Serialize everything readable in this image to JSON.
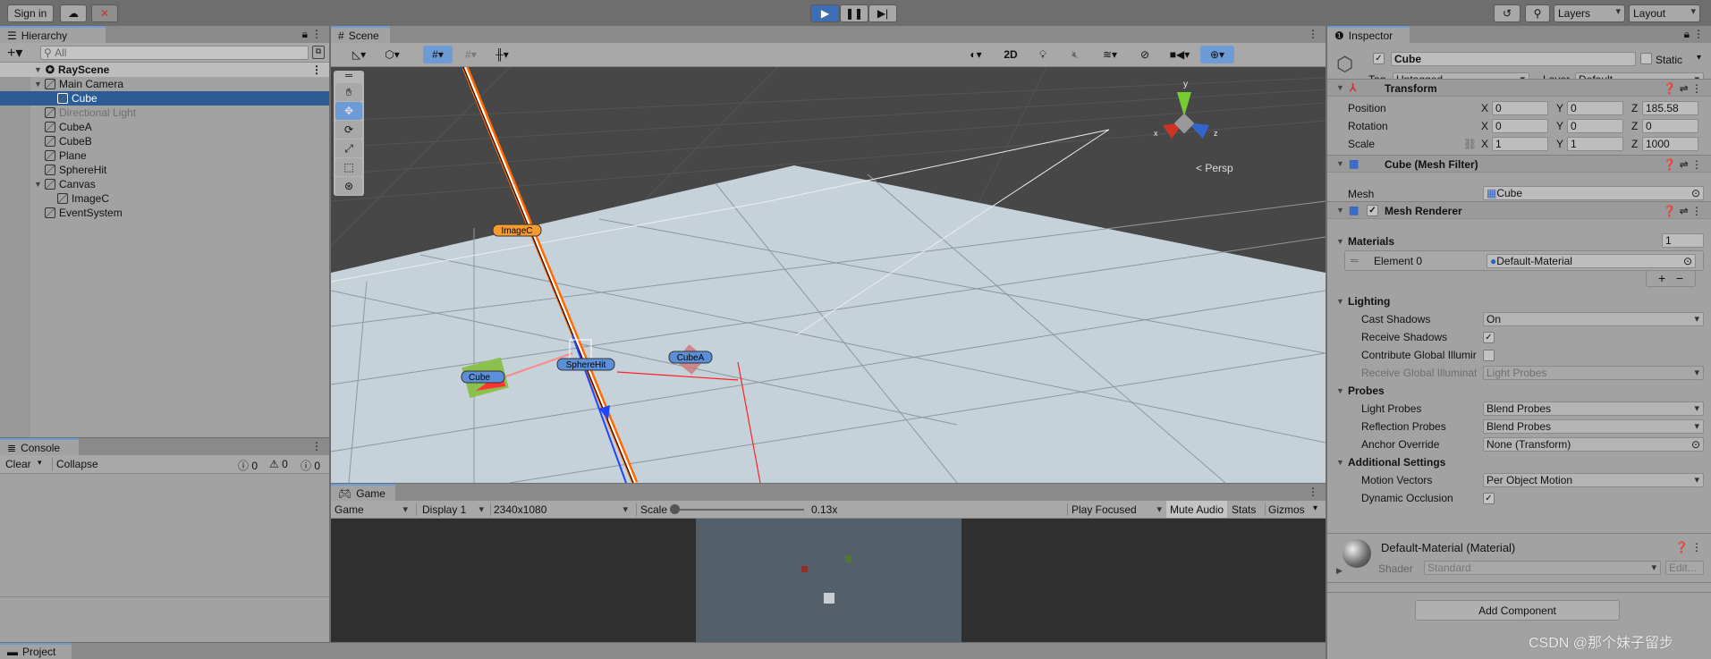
{
  "topbar": {
    "sign_in": "Sign in",
    "layers": "Layers",
    "layout": "Layout",
    "accent": "#3d6eb4"
  },
  "hierarchy": {
    "tab": "Hierarchy",
    "search_placeholder": "All",
    "scene": "RayScene",
    "items": [
      {
        "label": "Main Camera",
        "depth": 1,
        "expanded": true
      },
      {
        "label": "Cube",
        "depth": 2,
        "selected": true
      },
      {
        "label": "Directional Light",
        "depth": 1,
        "disabled": true
      },
      {
        "label": "CubeA",
        "depth": 1
      },
      {
        "label": "CubeB",
        "depth": 1
      },
      {
        "label": "Plane",
        "depth": 1
      },
      {
        "label": "SphereHit",
        "depth": 1
      },
      {
        "label": "Canvas",
        "depth": 1,
        "expanded": true
      },
      {
        "label": "ImageC",
        "depth": 2
      },
      {
        "label": "EventSystem",
        "depth": 1
      }
    ]
  },
  "console": {
    "tab": "Console",
    "clear": "Clear",
    "collapse": "Collapse",
    "logs": "0",
    "warnings": "0",
    "errors": "0"
  },
  "scene": {
    "tab": "Scene",
    "btn_2d": "2D",
    "persp": "Persp",
    "axis_x": "x",
    "axis_y": "y",
    "axis_z": "z",
    "labels": {
      "imagec": "ImageC",
      "spherehit": "SphereHit",
      "cubea": "CubeA",
      "cubeb": "Cube"
    }
  },
  "game": {
    "tab": "Game",
    "view": "Game",
    "display": "Display 1",
    "resolution": "2340x1080",
    "scale_label": "Scale",
    "scale_value": "0.13x",
    "play_focused": "Play Focused",
    "mute": "Mute Audio",
    "stats": "Stats",
    "gizmos": "Gizmos"
  },
  "project": {
    "tab": "Project"
  },
  "inspector": {
    "tab": "Inspector",
    "name": "Cube",
    "active": true,
    "static": "Static",
    "tag_label": "Tag",
    "tag": "Untagged",
    "layer_label": "Layer",
    "layer": "Default",
    "transform": {
      "title": "Transform",
      "position": "Position",
      "rotation": "Rotation",
      "scale": "Scale",
      "pos": [
        "0",
        "0",
        "185.58"
      ],
      "rot": [
        "0",
        "0",
        "0"
      ],
      "scl": [
        "1",
        "1",
        "1000"
      ],
      "x": "X",
      "y": "Y",
      "z": "Z"
    },
    "mesh_filter": {
      "title": "Cube (Mesh Filter)",
      "mesh_label": "Mesh",
      "mesh": "Cube"
    },
    "mesh_renderer": {
      "title": "Mesh Renderer",
      "materials": "Materials",
      "materials_count": "1",
      "element0": "Element 0",
      "material": "Default-Material",
      "lighting": "Lighting",
      "cast_shadows": "Cast Shadows",
      "cast_shadows_value": "On",
      "receive_shadows": "Receive Shadows",
      "contribute_gi": "Contribute Global Illumir",
      "receive_gi": "Receive Global Illuminat",
      "receive_gi_value": "Light Probes",
      "probes": "Probes",
      "light_probes": "Light Probes",
      "light_probes_value": "Blend Probes",
      "reflection_probes": "Reflection Probes",
      "reflection_probes_value": "Blend Probes",
      "anchor_override": "Anchor Override",
      "anchor_override_value": "None (Transform)",
      "additional": "Additional Settings",
      "motion_vectors": "Motion Vectors",
      "motion_vectors_value": "Per Object Motion",
      "dynamic_occlusion": "Dynamic Occlusion"
    },
    "material": {
      "title": "Default-Material (Material)",
      "shader_label": "Shader",
      "shader": "Standard",
      "edit": "Edit..."
    },
    "add_component": "Add Component"
  },
  "watermark": "CSDN @那个妹子留步"
}
